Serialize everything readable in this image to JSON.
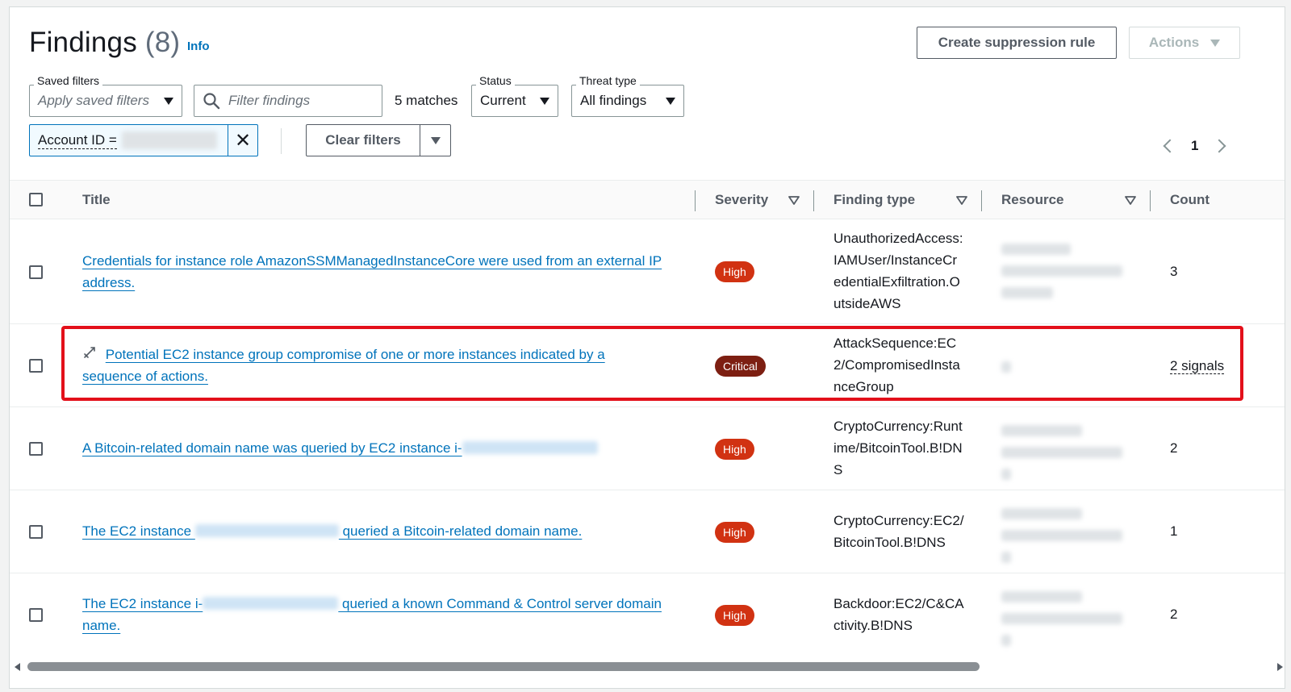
{
  "header": {
    "title": "Findings",
    "count": "(8)",
    "info_label": "Info",
    "create_suppression_label": "Create suppression rule",
    "actions_label": "Actions"
  },
  "filters": {
    "saved_filters_legend": "Saved filters",
    "saved_filters_placeholder": "Apply saved filters",
    "search_placeholder": "Filter findings",
    "matches": "5 matches",
    "status_legend": "Status",
    "status_value": "Current",
    "threat_type_legend": "Threat type",
    "threat_type_value": "All findings",
    "token_label": "Account ID =",
    "clear_filters_label": "Clear filters"
  },
  "pagination": {
    "current_page": "1"
  },
  "table": {
    "columns": {
      "title": "Title",
      "severity": "Severity",
      "finding_type": "Finding type",
      "resource": "Resource",
      "count": "Count"
    },
    "rows": [
      {
        "title": "Credentials for instance role AmazonSSMManagedInstanceCore were used from an external IP address.",
        "severity": "High",
        "finding_type": "UnauthorizedAccess:IAMUser/InstanceCredentialExfiltration.OutsideAWS",
        "count": "3"
      },
      {
        "title": "Potential EC2 instance group compromise of one or more instances indicated by a sequence of actions.",
        "severity": "Critical",
        "finding_type": "AttackSequence:EC2/CompromisedInstanceGroup",
        "count": "2 signals"
      },
      {
        "title_prefix": "A Bitcoin-related domain name was queried by EC2 instance i-",
        "severity": "High",
        "finding_type": "CryptoCurrency:Runtime/BitcoinTool.B!DNS",
        "count": "2"
      },
      {
        "title_prefix": "The EC2 instance ",
        "title_suffix": " queried a Bitcoin-related domain name.",
        "severity": "High",
        "finding_type": "CryptoCurrency:EC2/BitcoinTool.B!DNS",
        "count": "1"
      },
      {
        "title_prefix": "The EC2 instance i-",
        "title_suffix": " queried a known Command & Control server domain name.",
        "severity": "High",
        "finding_type": "Backdoor:EC2/C&CActivity.B!DNS",
        "count": "2"
      }
    ]
  },
  "colors": {
    "accent": "#0073bb",
    "high": "#d13212",
    "critical": "#7d1f12",
    "highlight": "#e3101a"
  }
}
